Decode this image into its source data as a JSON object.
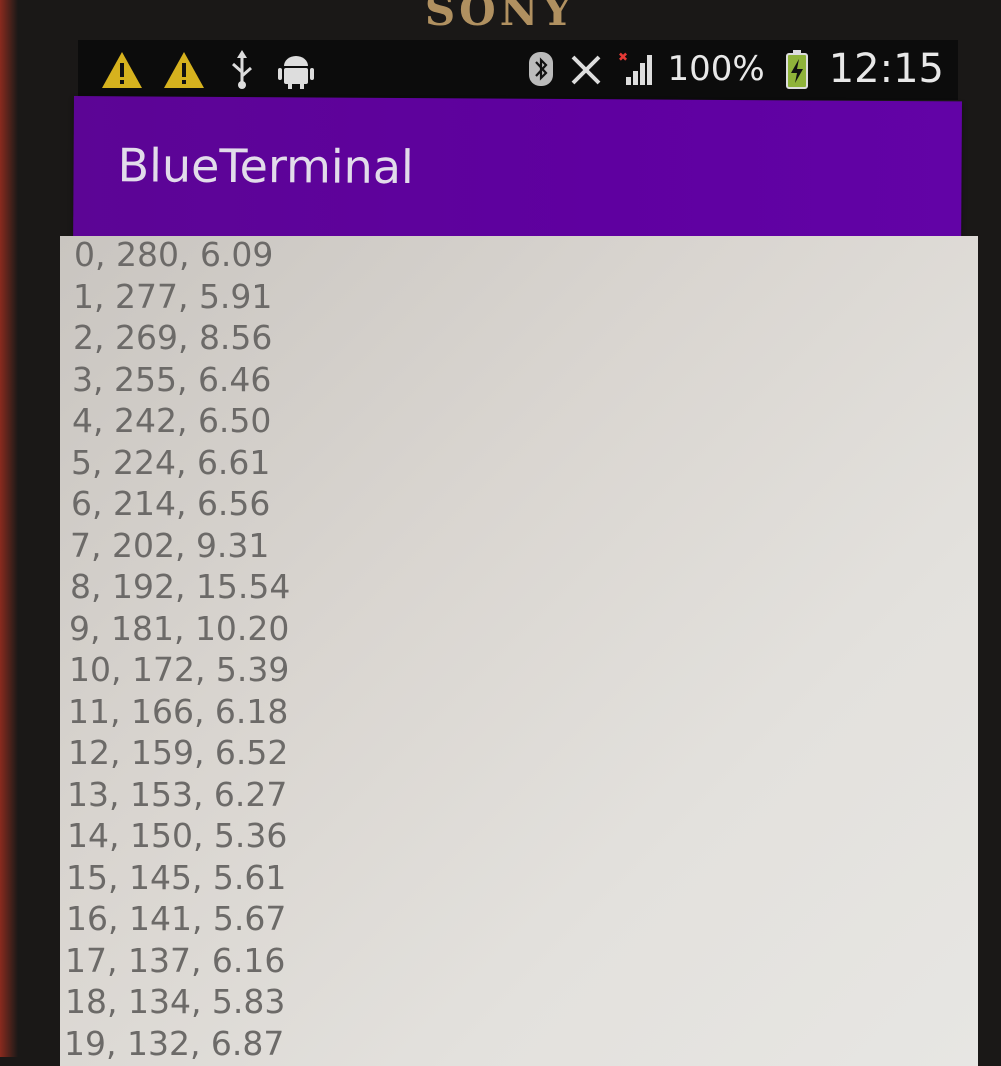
{
  "device": {
    "brand": "SONY"
  },
  "status_bar": {
    "left_icons": [
      "warning-icon",
      "warning-icon",
      "usb-icon",
      "android-debug-icon"
    ],
    "right_icons": [
      "bluetooth-icon",
      "vibrate-icon",
      "no-sim-signal-icon",
      "battery-charging-icon"
    ],
    "battery": "100%",
    "time": "12:15"
  },
  "app": {
    "title": "BlueTerminal",
    "accent": "#6000a0"
  },
  "terminal": {
    "lines": [
      "0, 280, 6.09",
      "1, 277, 5.91",
      "2, 269, 8.56",
      "3, 255, 6.46",
      "4, 242, 6.50",
      "5, 224, 6.61",
      "6, 214, 6.56",
      "7, 202, 9.31",
      "8, 192, 15.54",
      "9, 181, 10.20",
      "10, 172, 5.39",
      "11, 166, 6.18",
      "12, 159, 6.52",
      "13, 153, 6.27",
      "14, 150, 5.36",
      "15, 145, 5.61",
      "16, 141, 5.67",
      "17, 137, 6.16",
      "18, 134, 5.83",
      "19, 132, 6.87"
    ]
  }
}
